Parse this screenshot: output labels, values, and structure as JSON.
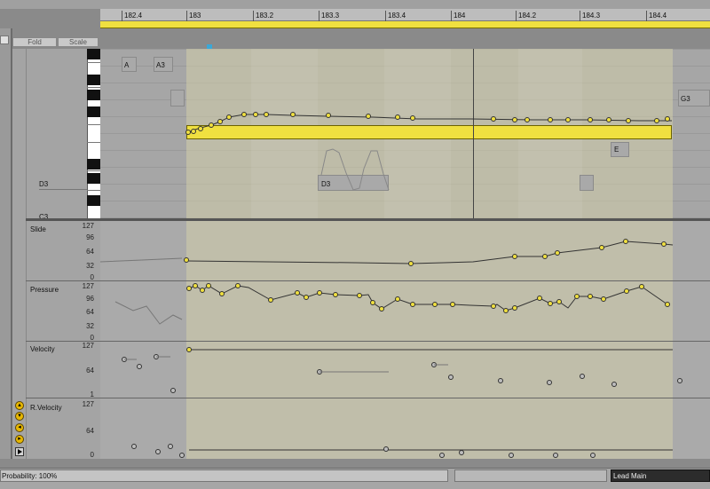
{
  "ruler": {
    "bars": [
      "182.4",
      "183",
      "183.2",
      "183.3",
      "183.4",
      "184",
      "184.2",
      "184.3",
      "184.4"
    ]
  },
  "left_controls": {
    "fold_label": "Fold",
    "scale_label": "Scale"
  },
  "notes": {
    "a_label": "A",
    "a3_label": "A3",
    "g3_label": "G3",
    "e_label": "E",
    "d3_clip_label": "D3"
  },
  "piano": {
    "d3_label": "D3",
    "c3_label": "C3"
  },
  "lanes": {
    "slide": {
      "name": "Slide",
      "ticks": [
        "127",
        "96",
        "64",
        "32",
        "0"
      ]
    },
    "pressure": {
      "name": "Pressure",
      "ticks": [
        "127",
        "96",
        "64",
        "32",
        "0"
      ]
    },
    "velocity": {
      "name": "Velocity",
      "ticks": [
        "127",
        "64",
        "1"
      ]
    },
    "rvelocity": {
      "name": "R.Velocity",
      "ticks": [
        "127",
        "64",
        "0"
      ]
    }
  },
  "status_bar": {
    "probability": "Probability: 100%",
    "lead_main": "Lead Main"
  },
  "colors": {
    "accent_yellow": "#f0e040",
    "region_tint": "#c9c6a6",
    "background": "#a8a8a8"
  }
}
